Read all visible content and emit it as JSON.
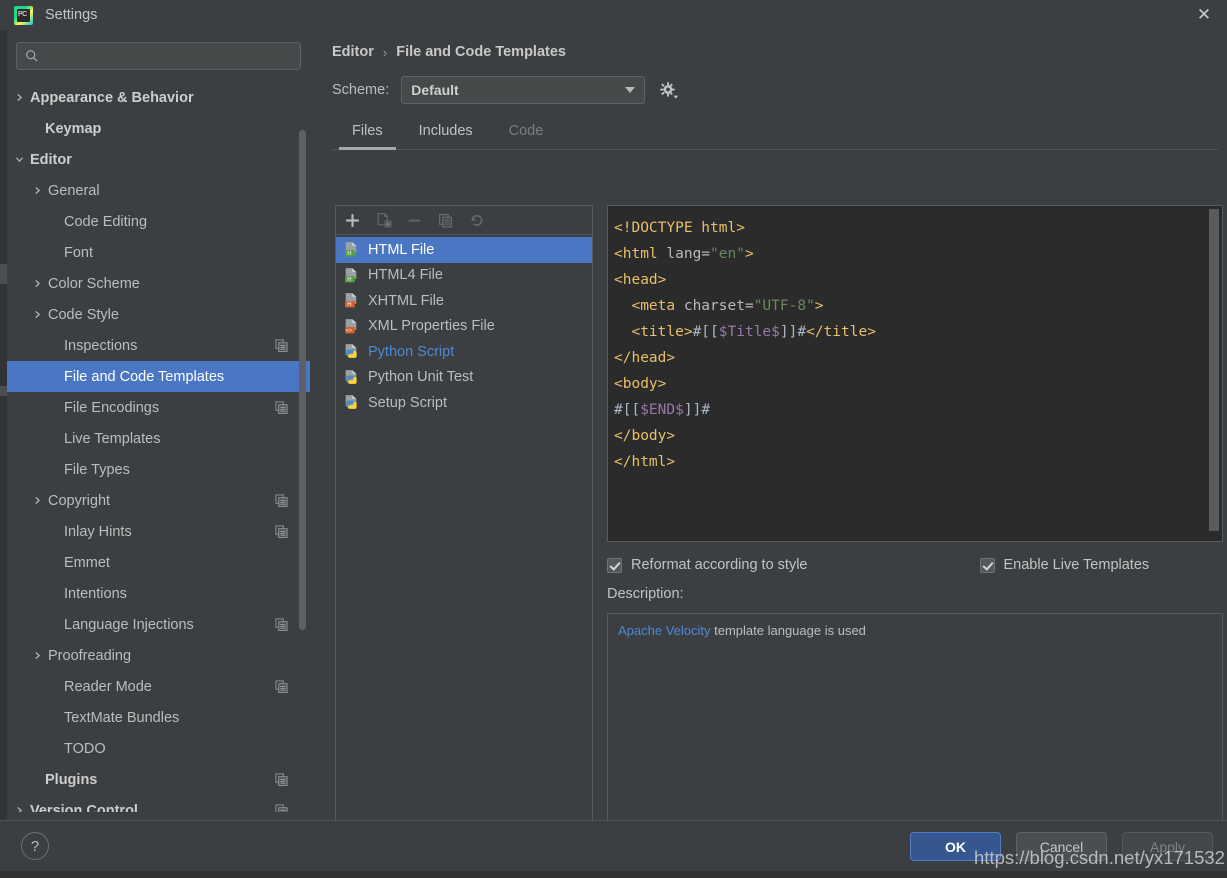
{
  "window": {
    "title": "Settings",
    "logo_icon": "pycharm-logo-icon",
    "logo_text": "PC",
    "close_icon": "close-icon"
  },
  "sidebar": {
    "search": {
      "placeholder": "",
      "value": "",
      "icon": "search-icon"
    },
    "items": [
      {
        "label": "Appearance & Behavior",
        "arrow": "chevron-right",
        "indent": 22,
        "bold": true,
        "selected": false,
        "copy_icon": false
      },
      {
        "label": "Keymap",
        "arrow": "none",
        "indent": 38,
        "bold": true,
        "selected": false,
        "copy_icon": false
      },
      {
        "label": "Editor",
        "arrow": "chevron-down",
        "indent": 22,
        "bold": true,
        "selected": false,
        "copy_icon": false
      },
      {
        "label": "General",
        "arrow": "chevron-right",
        "indent": 40,
        "bold": false,
        "selected": false,
        "copy_icon": false
      },
      {
        "label": "Code Editing",
        "arrow": "none",
        "indent": 57,
        "bold": false,
        "selected": false,
        "copy_icon": false
      },
      {
        "label": "Font",
        "arrow": "none",
        "indent": 57,
        "bold": false,
        "selected": false,
        "copy_icon": false
      },
      {
        "label": "Color Scheme",
        "arrow": "chevron-right",
        "indent": 40,
        "bold": false,
        "selected": false,
        "copy_icon": false
      },
      {
        "label": "Code Style",
        "arrow": "chevron-right",
        "indent": 40,
        "bold": false,
        "selected": false,
        "copy_icon": false
      },
      {
        "label": "Inspections",
        "arrow": "none",
        "indent": 57,
        "bold": false,
        "selected": false,
        "copy_icon": true
      },
      {
        "label": "File and Code Templates",
        "arrow": "none",
        "indent": 57,
        "bold": false,
        "selected": true,
        "copy_icon": false
      },
      {
        "label": "File Encodings",
        "arrow": "none",
        "indent": 57,
        "bold": false,
        "selected": false,
        "copy_icon": true
      },
      {
        "label": "Live Templates",
        "arrow": "none",
        "indent": 57,
        "bold": false,
        "selected": false,
        "copy_icon": false
      },
      {
        "label": "File Types",
        "arrow": "none",
        "indent": 57,
        "bold": false,
        "selected": false,
        "copy_icon": false
      },
      {
        "label": "Copyright",
        "arrow": "chevron-right",
        "indent": 40,
        "bold": false,
        "selected": false,
        "copy_icon": true
      },
      {
        "label": "Inlay Hints",
        "arrow": "none",
        "indent": 57,
        "bold": false,
        "selected": false,
        "copy_icon": true
      },
      {
        "label": "Emmet",
        "arrow": "none",
        "indent": 57,
        "bold": false,
        "selected": false,
        "copy_icon": false
      },
      {
        "label": "Intentions",
        "arrow": "none",
        "indent": 57,
        "bold": false,
        "selected": false,
        "copy_icon": false
      },
      {
        "label": "Language Injections",
        "arrow": "none",
        "indent": 57,
        "bold": false,
        "selected": false,
        "copy_icon": true
      },
      {
        "label": "Proofreading",
        "arrow": "chevron-right",
        "indent": 40,
        "bold": false,
        "selected": false,
        "copy_icon": false
      },
      {
        "label": "Reader Mode",
        "arrow": "none",
        "indent": 57,
        "bold": false,
        "selected": false,
        "copy_icon": true
      },
      {
        "label": "TextMate Bundles",
        "arrow": "none",
        "indent": 57,
        "bold": false,
        "selected": false,
        "copy_icon": false
      },
      {
        "label": "TODO",
        "arrow": "none",
        "indent": 57,
        "bold": false,
        "selected": false,
        "copy_icon": false
      },
      {
        "label": "Plugins",
        "arrow": "none",
        "indent": 38,
        "bold": true,
        "selected": false,
        "copy_icon": true
      },
      {
        "label": "Version Control",
        "arrow": "chevron-right",
        "indent": 22,
        "bold": true,
        "selected": false,
        "copy_icon": true
      }
    ]
  },
  "breadcrumb": {
    "parent": "Editor",
    "separator": "›",
    "current": "File and Code Templates"
  },
  "scheme": {
    "label": "Scheme:",
    "selected": "Default",
    "options": [
      "Default"
    ],
    "gear_icon": "gear-icon"
  },
  "tabs": [
    {
      "label": "Files",
      "state": "active"
    },
    {
      "label": "Includes",
      "state": "normal"
    },
    {
      "label": "Code",
      "state": "disabled"
    }
  ],
  "list_toolbar": [
    {
      "icon": "add-icon",
      "enabled": true
    },
    {
      "icon": "copy-template-icon",
      "enabled": false
    },
    {
      "icon": "remove-icon",
      "enabled": false
    },
    {
      "icon": "duplicate-icon",
      "enabled": false
    },
    {
      "icon": "reset-icon",
      "enabled": false
    }
  ],
  "template_list": [
    {
      "label": "HTML File",
      "icon": "html-file-icon",
      "selected": true,
      "link": false
    },
    {
      "label": "HTML4 File",
      "icon": "html-file-icon",
      "selected": false,
      "link": false
    },
    {
      "label": "XHTML File",
      "icon": "xhtml-file-icon",
      "selected": false,
      "link": false
    },
    {
      "label": "XML Properties File",
      "icon": "xml-file-icon",
      "selected": false,
      "link": false
    },
    {
      "label": "Python Script",
      "icon": "python-file-icon",
      "selected": false,
      "link": true
    },
    {
      "label": "Python Unit Test",
      "icon": "python-file-icon",
      "selected": false,
      "link": false
    },
    {
      "label": "Setup Script",
      "icon": "python-file-icon",
      "selected": false,
      "link": false
    }
  ],
  "editor": {
    "lines": [
      [
        {
          "t": "<!DOCTYPE html>",
          "c": "tag"
        }
      ],
      [
        {
          "t": "<html ",
          "c": "tag"
        },
        {
          "t": "lang=",
          "c": "attr"
        },
        {
          "t": "\"en\"",
          "c": "str"
        },
        {
          "t": ">",
          "c": "tag"
        }
      ],
      [
        {
          "t": "<head>",
          "c": "tag"
        }
      ],
      [
        {
          "t": "  <meta ",
          "c": "tag"
        },
        {
          "t": "charset=",
          "c": "attr"
        },
        {
          "t": "\"UTF-8\"",
          "c": "str"
        },
        {
          "t": ">",
          "c": "tag"
        }
      ],
      [
        {
          "t": "  <title>",
          "c": "tag"
        },
        {
          "t": "#[[",
          "c": "plain"
        },
        {
          "t": "$Title$",
          "c": "var"
        },
        {
          "t": "]]#",
          "c": "plain"
        },
        {
          "t": "</title>",
          "c": "tag"
        }
      ],
      [
        {
          "t": "</head>",
          "c": "tag"
        }
      ],
      [
        {
          "t": "<body>",
          "c": "tag"
        }
      ],
      [
        {
          "t": "#[[",
          "c": "plain"
        },
        {
          "t": "$END$",
          "c": "var"
        },
        {
          "t": "]]#",
          "c": "plain"
        }
      ],
      [
        {
          "t": "</body>",
          "c": "tag"
        }
      ],
      [
        {
          "t": "</html>",
          "c": "tag"
        }
      ]
    ]
  },
  "options": {
    "reformat": {
      "label": "Reformat according to style",
      "checked": true
    },
    "live_templates": {
      "label": "Enable Live Templates",
      "checked": true
    }
  },
  "description": {
    "label": "Description:",
    "link_text": "Apache Velocity",
    "rest_text": " template language is used"
  },
  "footer": {
    "help_icon": "help-icon",
    "help_label": "?",
    "ok": "OK",
    "cancel": "Cancel",
    "apply": "Apply"
  },
  "watermark": "https://blog.csdn.net/yx171532",
  "colors": {
    "selection": "#4a76c4",
    "link": "#4e87d3",
    "ok_button": "#36568f",
    "editor_bg": "#2b2b2b",
    "panel_bg": "#3c3f41"
  }
}
